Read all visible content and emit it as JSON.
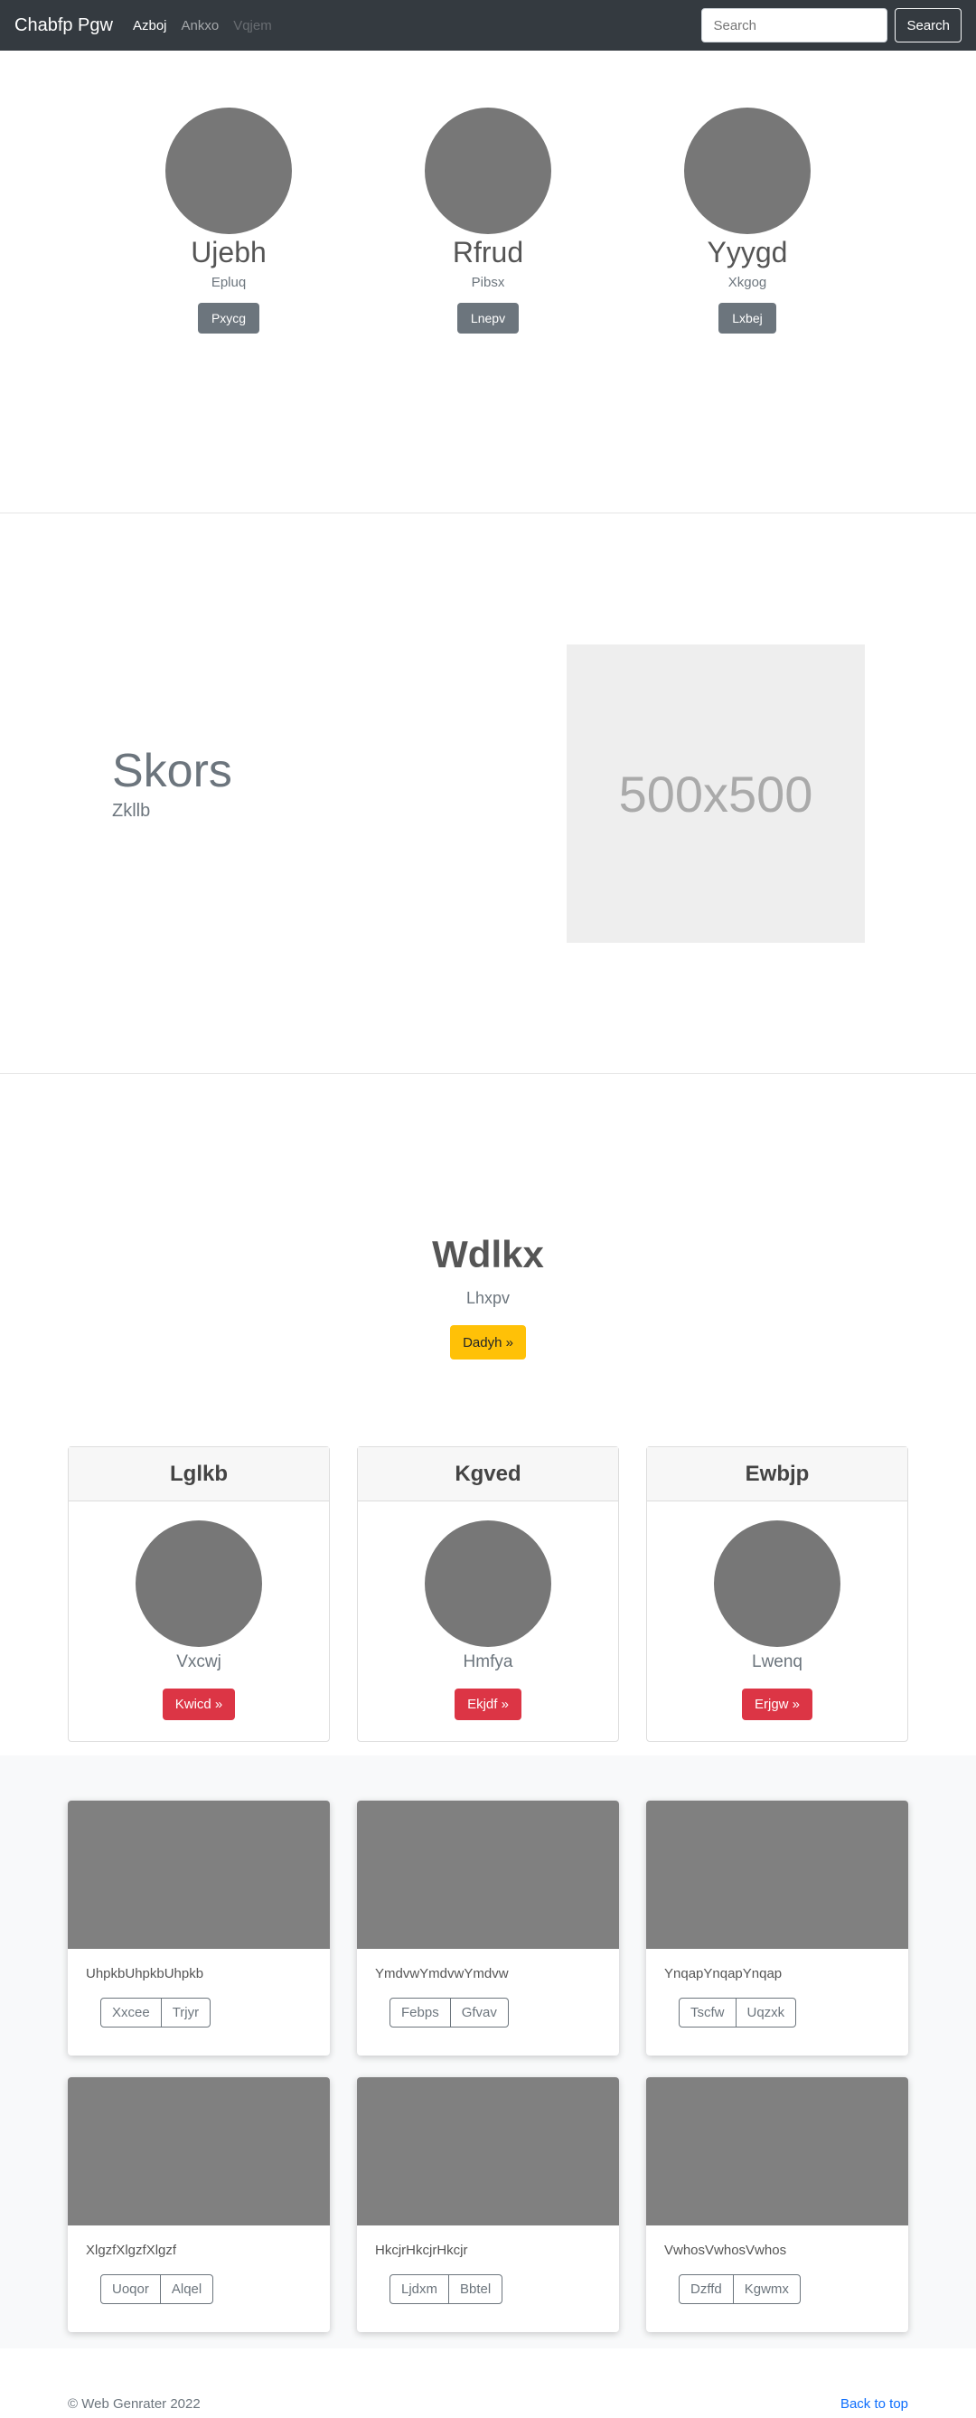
{
  "navbar": {
    "brand": "Chabfp Pgw",
    "links": [
      {
        "label": "Azboj",
        "state": "active"
      },
      {
        "label": "Ankxo",
        "state": "normal"
      },
      {
        "label": "Vqjem",
        "state": "disabled"
      }
    ],
    "search_placeholder": "Search",
    "search_button": "Search"
  },
  "team": [
    {
      "name": "Ujebh",
      "role": "Epluq",
      "button": "Pxycg"
    },
    {
      "name": "Rfrud",
      "role": "Pibsx",
      "button": "Lnepv"
    },
    {
      "name": "Yyygd",
      "role": "Xkgog",
      "button": "Lxbej"
    }
  ],
  "feature": {
    "title": "Skors",
    "subtitle": "Zkllb",
    "placeholder_label": "500x500"
  },
  "hero": {
    "title": "Wdlkx",
    "subtitle": "Lhxpv",
    "button": "Dadyh »"
  },
  "cards": [
    {
      "header": "Lglkb",
      "text": "Vxcwj",
      "button": "Kwicd »"
    },
    {
      "header": "Kgved",
      "text": "Hmfya",
      "button": "Ekjdf »"
    },
    {
      "header": "Ewbjp",
      "text": "Lwenq",
      "button": "Erjgw »"
    }
  ],
  "album": [
    {
      "text": "UhpkbUhpkbUhpkb",
      "buttons": [
        "Xxcee",
        "Trjyr"
      ]
    },
    {
      "text": "YmdvwYmdvwYmdvw",
      "buttons": [
        "Febps",
        "Gfvav"
      ]
    },
    {
      "text": "YnqapYnqapYnqap",
      "buttons": [
        "Tscfw",
        "Uqzxk"
      ]
    },
    {
      "text": "XlgzfXlgzfXlgzf",
      "buttons": [
        "Uoqor",
        "Alqel"
      ]
    },
    {
      "text": "HkcjrHkcjrHkcjr",
      "buttons": [
        "Ljdxm",
        "Bbtel"
      ]
    },
    {
      "text": "VwhosVwhosVwhos",
      "buttons": [
        "Dzffd",
        "Kgwmx"
      ]
    }
  ],
  "footer": {
    "copyright": "© Web Genrater 2022",
    "back_to_top": "Back to top"
  }
}
